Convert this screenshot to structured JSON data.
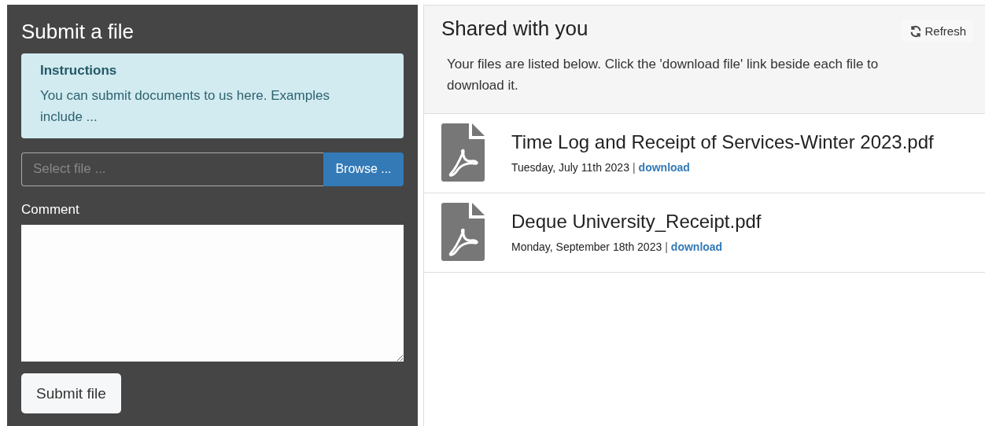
{
  "submit_panel": {
    "title": "Submit a file",
    "instructions": {
      "heading": "Instructions",
      "text": "You can submit documents to us here. Examples include ..."
    },
    "file_field": {
      "placeholder": "Select file ..."
    },
    "browse_button": "Browse ...",
    "comment_label": "Comment",
    "submit_button": "Submit file"
  },
  "shared_panel": {
    "title": "Shared with you",
    "refresh_button": "Refresh",
    "description": "Your files are listed below. Click the 'download file' link beside each file to download it.",
    "files": [
      {
        "name": "Time Log and Receipt of Services-Winter 2023.pdf",
        "date": "Tuesday, July 11th 2023",
        "separator": "|",
        "link": "download"
      },
      {
        "name": "Deque University_Receipt.pdf",
        "date": "Monday, September 18th 2023",
        "separator": "|",
        "link": "download"
      }
    ]
  }
}
